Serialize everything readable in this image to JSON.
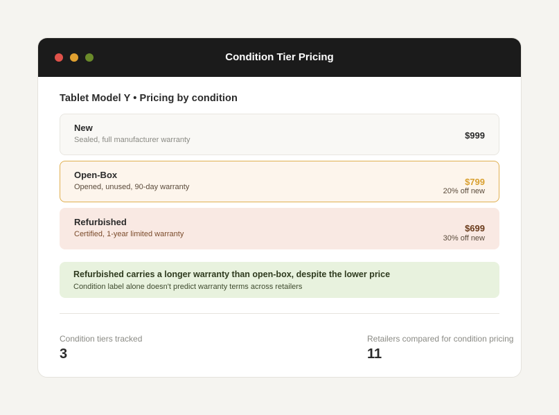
{
  "window": {
    "title": "Condition Tier Pricing",
    "controls": {
      "close_color": "#e0524a",
      "minimize_color": "#e0a030",
      "zoom_color": "#6a8a2a"
    }
  },
  "heading": "Tablet Model Y • Pricing by condition",
  "tiers": [
    {
      "name": "New",
      "description": "Sealed, full manufacturer warranty",
      "price": "$999",
      "discount": ""
    },
    {
      "name": "Open-Box",
      "description": "Opened, unused, 90-day warranty",
      "price": "$799",
      "discount": "20% off new"
    },
    {
      "name": "Refurbished",
      "description": "Certified, 1-year limited warranty",
      "price": "$699",
      "discount": "30% off new"
    }
  ],
  "callout": {
    "title": "Refurbished carries a longer warranty than open-box, despite the lower price",
    "subtitle": "Condition label alone doesn't predict warranty terms across retailers"
  },
  "stats": [
    {
      "label": "Condition tiers tracked",
      "value": "3"
    },
    {
      "label": "Retailers compared for condition pricing",
      "value": "11"
    }
  ]
}
